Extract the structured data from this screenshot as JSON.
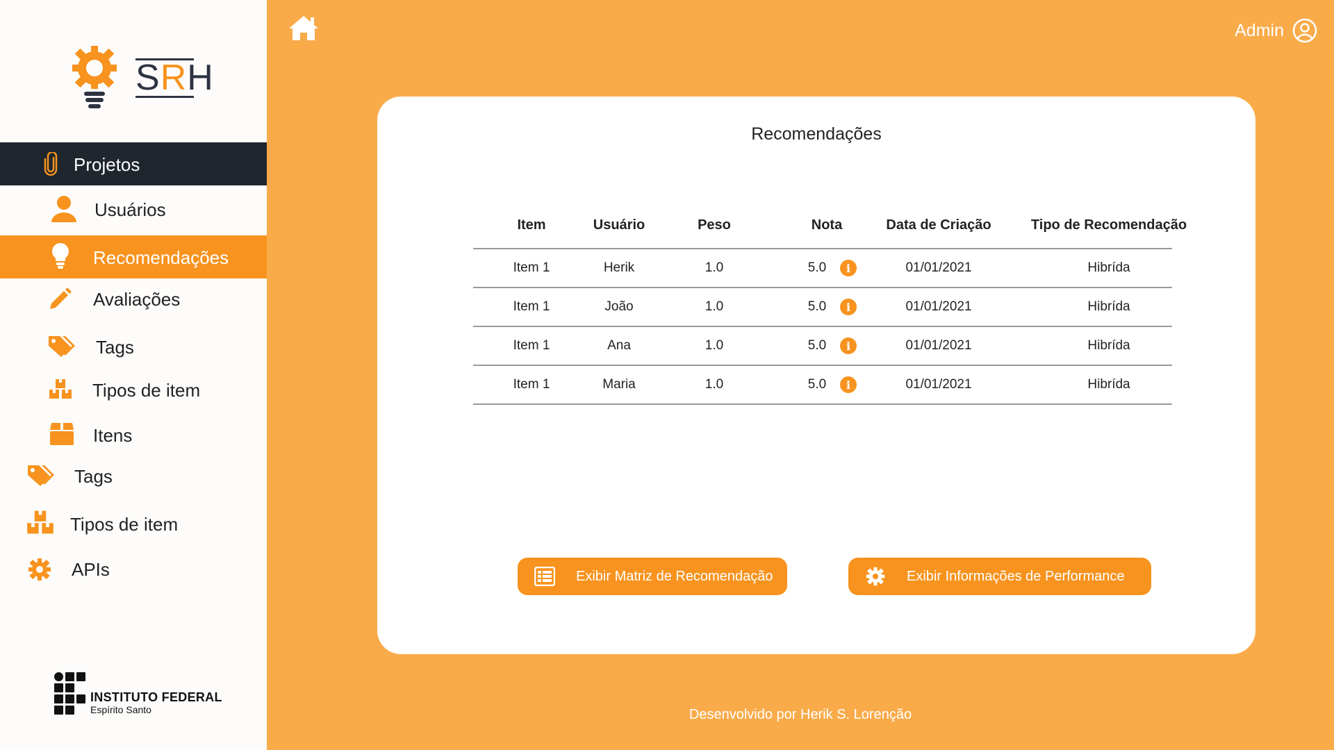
{
  "app": {
    "logo_prefix": "S",
    "logo_accent": "R",
    "logo_suffix": "H"
  },
  "sidebar": {
    "items": [
      {
        "label": "Projetos",
        "icon": "paperclip-icon"
      },
      {
        "label": "Usuários",
        "icon": "user-icon"
      },
      {
        "label": "Recomendações",
        "icon": "lightbulb-icon"
      },
      {
        "label": "Avaliações",
        "icon": "pencil-icon"
      },
      {
        "label": "Tags",
        "icon": "tags-icon"
      },
      {
        "label": "Tipos de item",
        "icon": "boxes-icon"
      },
      {
        "label": "Itens",
        "icon": "box-icon"
      },
      {
        "label": "Tags",
        "icon": "tags-icon"
      },
      {
        "label": "Tipos de item",
        "icon": "boxes-icon"
      },
      {
        "label": "APIs",
        "icon": "gear-icon"
      }
    ],
    "institution": {
      "name": "INSTITUTO FEDERAL",
      "campus": "Espírito Santo"
    }
  },
  "header": {
    "user": "Admin"
  },
  "main": {
    "title": "Recomendações",
    "columns": [
      "Item",
      "Usuário",
      "Peso",
      "Nota",
      "Data de Criação",
      "Tipo de Recomendação"
    ],
    "rows": [
      {
        "item": "Item 1",
        "user": "Herik",
        "weight": "1.0",
        "score": "5.0",
        "date": "01/01/2021",
        "type": "Hibrída"
      },
      {
        "item": "Item 1",
        "user": "João",
        "weight": "1.0",
        "score": "5.0",
        "date": "01/01/2021",
        "type": "Hibrída"
      },
      {
        "item": "Item 1",
        "user": "Ana",
        "weight": "1.0",
        "score": "5.0",
        "date": "01/01/2021",
        "type": "Hibrída"
      },
      {
        "item": "Item 1",
        "user": "Maria",
        "weight": "1.0",
        "score": "5.0",
        "date": "01/01/2021",
        "type": "Hibrída"
      }
    ],
    "buttons": {
      "matrix": "Exibir Matriz de Recomendação",
      "performance": "Exibir Informações de Performance"
    }
  },
  "footer": {
    "credit": "Desenvolvido por Herik S. Lorenção"
  },
  "colors": {
    "accent": "#f7931e",
    "background": "#f9ab4a",
    "dark": "#1f262e"
  }
}
